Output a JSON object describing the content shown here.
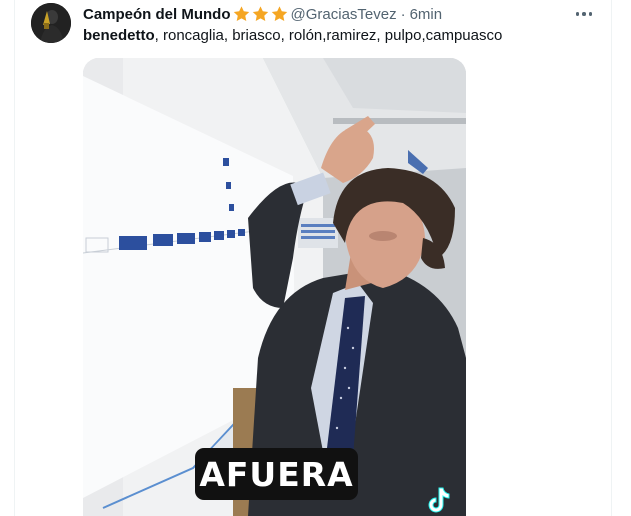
{
  "tweet": {
    "display_name": "Campeón del Mundo",
    "star_icons": [
      "star-icon",
      "star-icon",
      "star-icon"
    ],
    "handle": "@GraciasTevez",
    "separator": "·",
    "time": "6min",
    "text_bold": "benedetto",
    "text_rest": ", roncaglia, briasco, rolón,ramirez, pulpo,campuasco",
    "media": {
      "caption": "AFUERA",
      "watermark_icon": "tiktok-icon"
    }
  },
  "colors": {
    "text": "#0f1419",
    "secondary": "#536471",
    "star": "#f5a623",
    "caption_bg": "#111111"
  }
}
